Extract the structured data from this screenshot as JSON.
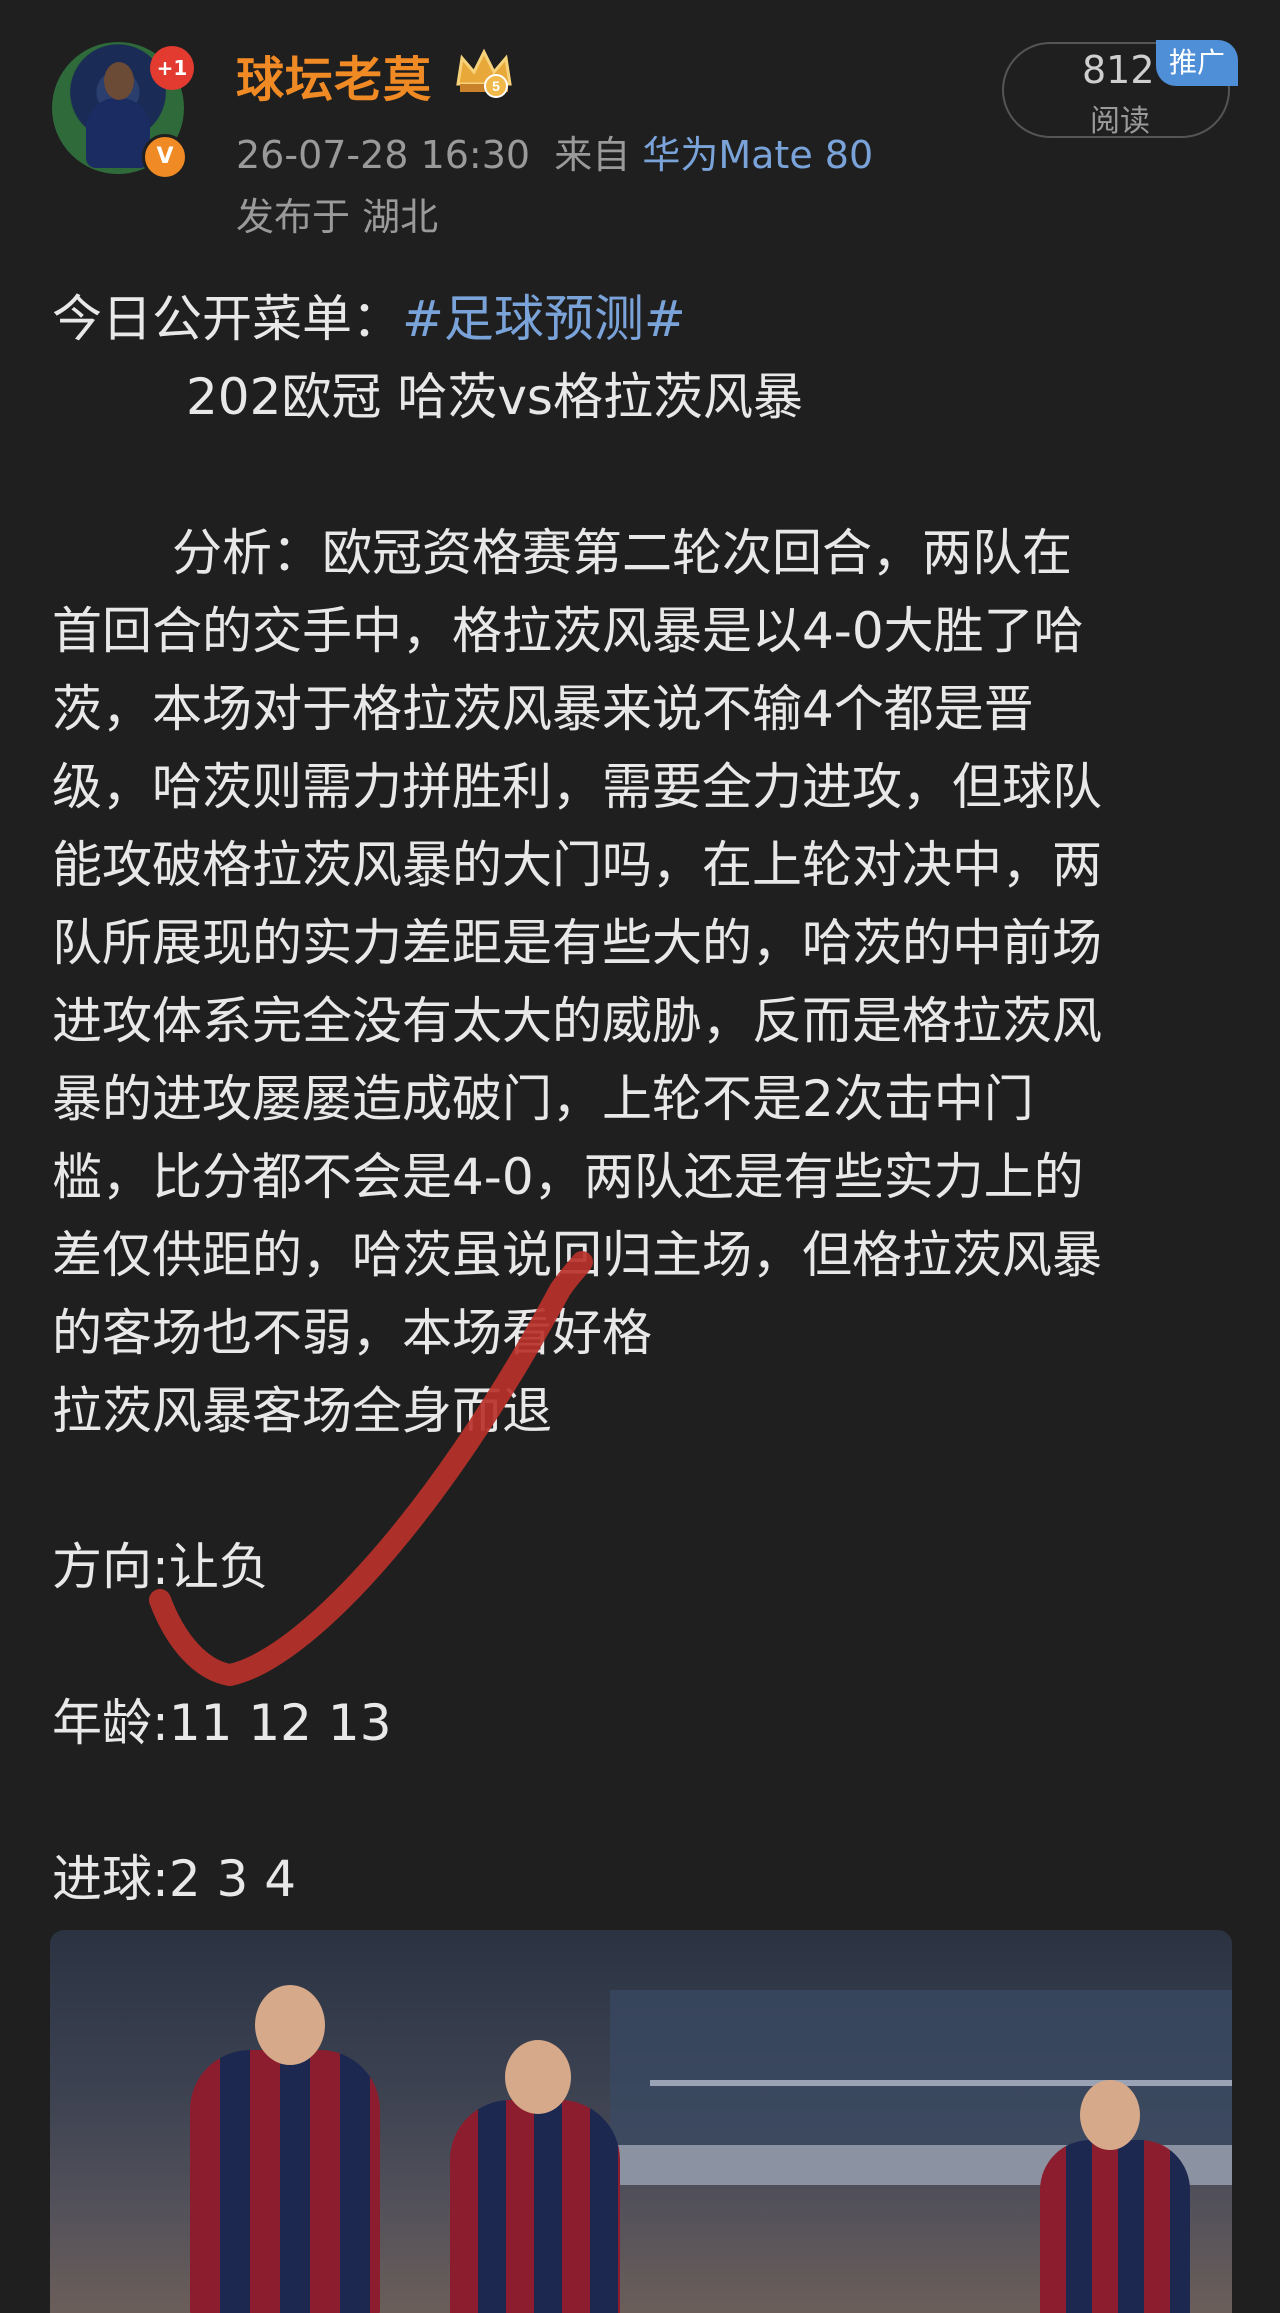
{
  "author": {
    "name": "球坛老莫",
    "avatar_badge": "+1",
    "verified_mark": "V",
    "level_icon": "crown-level-5-icon"
  },
  "meta": {
    "timestamp": "26-07-28 16:30",
    "from_label": "来自",
    "device": "华为Mate 80",
    "location": "发布于 湖北"
  },
  "reads": {
    "count": "812",
    "label": "阅读",
    "promo_tag": "推广"
  },
  "post": {
    "intro_prefix": "今日公开菜单：",
    "hashtag": "#足球预测#",
    "match": "202欧冠  哈茨vs格拉茨风暴",
    "analysis_lines": [
      "分析：欧冠资格赛第二轮次回合，两队在",
      "首回合的交手中，格拉茨风暴是以4-0大胜了哈",
      "茨，本场对于格拉茨风暴来说不输4个都是晋",
      "级，哈茨则需力拼胜利，需要全力进攻，但球队",
      "能攻破格拉茨风暴的大门吗，在上轮对决中，两",
      "队所展现的实力差距是有些大的，哈茨的中前场",
      "进攻体系完全没有太大的威胁，反而是格拉茨风",
      "暴的进攻屡屡造成破门，上轮不是2次击中门",
      "槛，比分都不会是4-0，两队还是有些实力上的",
      "差仅供距的，哈茨虽说回归主场，但格拉茨风暴",
      "的客场也不弱，本场看好格",
      "拉茨风暴客场全身而退"
    ],
    "direction": "方向:让负",
    "age": "年龄:11    12    13",
    "goals": "进球:2     3      4"
  },
  "colors": {
    "background": "#1f1f1f",
    "username": "#f08a24",
    "link": "#7aa3d9",
    "checkmark": "#b8322a",
    "promo": "#4f8fd8"
  }
}
